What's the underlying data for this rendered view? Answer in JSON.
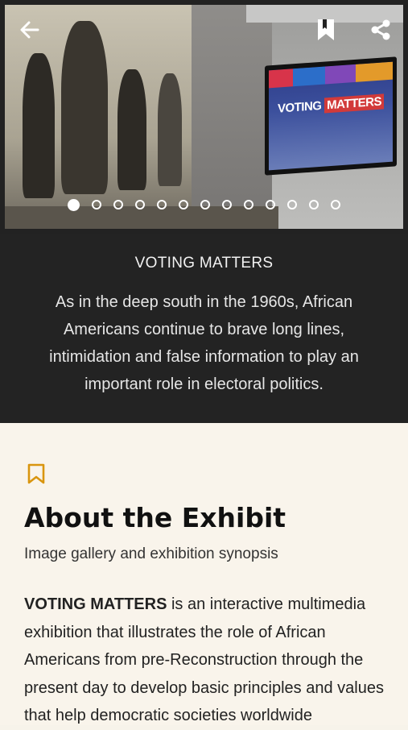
{
  "header": {
    "back_icon": "arrow-left-icon",
    "bookmark_icon": "bookmark-icon",
    "share_icon": "share-icon"
  },
  "hero": {
    "tv_title_part1": "VOTING",
    "tv_title_part2": "MATTERS",
    "carousel_total": 13,
    "carousel_active_index": 0
  },
  "caption": {
    "title": "VOTING MATTERS",
    "text": "As in the deep south in the 1960s, African Americans continue to brave long lines, intimidation and false information to play an important role in electoral politics."
  },
  "about": {
    "bookmark_icon": "bookmark-outline-icon",
    "accent_color": "#d9950e",
    "title": "About the Exhibit",
    "subtitle": "Image gallery and exhibition synopsis",
    "body_bold": "VOTING MATTERS",
    "body_rest": " is an interactive multimedia exhibition that illustrates the role of African Americans from pre-Reconstruction through the present day to develop basic principles and values that help democratic societies worldwide"
  }
}
